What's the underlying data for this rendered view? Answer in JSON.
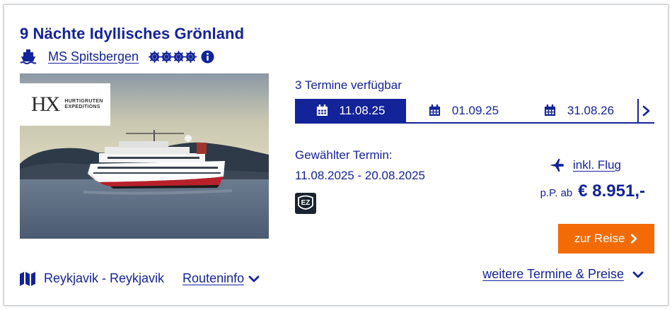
{
  "cruise": {
    "title": "9 Nächte Idyllisches Grönland",
    "ship_name": "MS Spitsbergen",
    "rating": 4,
    "icons": {
      "ship": "ship-icon",
      "rating": "ship-wheel-icon",
      "info": "info-icon"
    }
  },
  "photo": {
    "logo_mark": "HX",
    "logo_text_line1": "HURTIGRUTEN",
    "logo_text_line2": "EXPEDITIONS"
  },
  "dates": {
    "available_label": "3 Termine verfügbar",
    "tabs": [
      {
        "label": "11.08.25",
        "active": true
      },
      {
        "label": "01.09.25",
        "active": false
      },
      {
        "label": "31.08.26",
        "active": false
      }
    ],
    "selected_label": "Gewählter Termin:",
    "selected_range": "11.08.2025 - 20.08.2025",
    "badge_text": "EZ"
  },
  "price": {
    "flight_label": "inkl. Flug",
    "prefix": "p.P. ab",
    "value": "€ 8.951,-"
  },
  "cta": {
    "label": "zur Reise"
  },
  "route": {
    "text": "Reykjavik - Reykjavik",
    "info_label": "Routeninfo",
    "more_label": "weitere Termine & Preise"
  },
  "colors": {
    "brand_blue": "#13239a",
    "cta_orange": "#f26b06"
  }
}
